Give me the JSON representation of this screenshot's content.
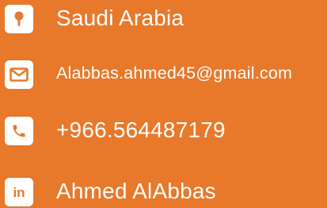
{
  "colors": {
    "background": "#E8782A",
    "text": "#FFFFFF",
    "icon_bg": "#FFFFFF",
    "icon_fg": "#E8782A"
  },
  "contacts": [
    {
      "icon": "map-pin-icon",
      "text": "Saudi Arabia"
    },
    {
      "icon": "envelope-icon",
      "text": "Alabbas.ahmed45@gmail.com"
    },
    {
      "icon": "phone-icon",
      "text": "+966.564487179"
    },
    {
      "icon": "linkedin-icon",
      "icon_text": "in",
      "text": "Ahmed AlAbbas"
    }
  ]
}
